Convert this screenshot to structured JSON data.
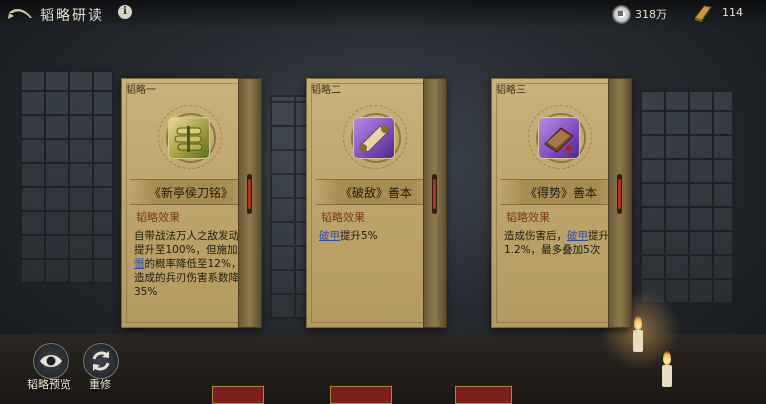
{
  "header": {
    "title": "韬略研读",
    "info_icon": "i",
    "currency_value": "318万",
    "currency_icon": "coin-icon",
    "book_value": "114",
    "book_icon": "book-icon"
  },
  "cards": [
    {
      "label": "韬略一",
      "name": "《新亭侯刀铭》",
      "effect_title": "韬略效果",
      "effect_parts": [
        "自带战法万人之敌发动率提升至100%，但施加",
        "震慑",
        "的概率降低至12%，造成的兵刃伤害系数降低35%"
      ],
      "icon": "scroll-bundle-icon"
    },
    {
      "label": "韬略二",
      "name": "《破敌》善本",
      "effect_title": "韬略效果",
      "effect_parts": [
        "破甲",
        "提升5%"
      ],
      "icon": "scroll-purple-icon"
    },
    {
      "label": "韬略三",
      "name": "《得势》善本",
      "effect_title": "韬略效果",
      "effect_parts": [
        "造成伤害后，",
        "破甲",
        "提升1.2%，最多叠加5次"
      ],
      "icon": "book-purple-icon"
    }
  ],
  "footer": {
    "preview_label": "韬略预览",
    "reset_label": "重修"
  },
  "colors": {
    "card_bg": "#c2aa72",
    "keyword": "#2e4da8",
    "effect_title": "#7a3a10"
  }
}
